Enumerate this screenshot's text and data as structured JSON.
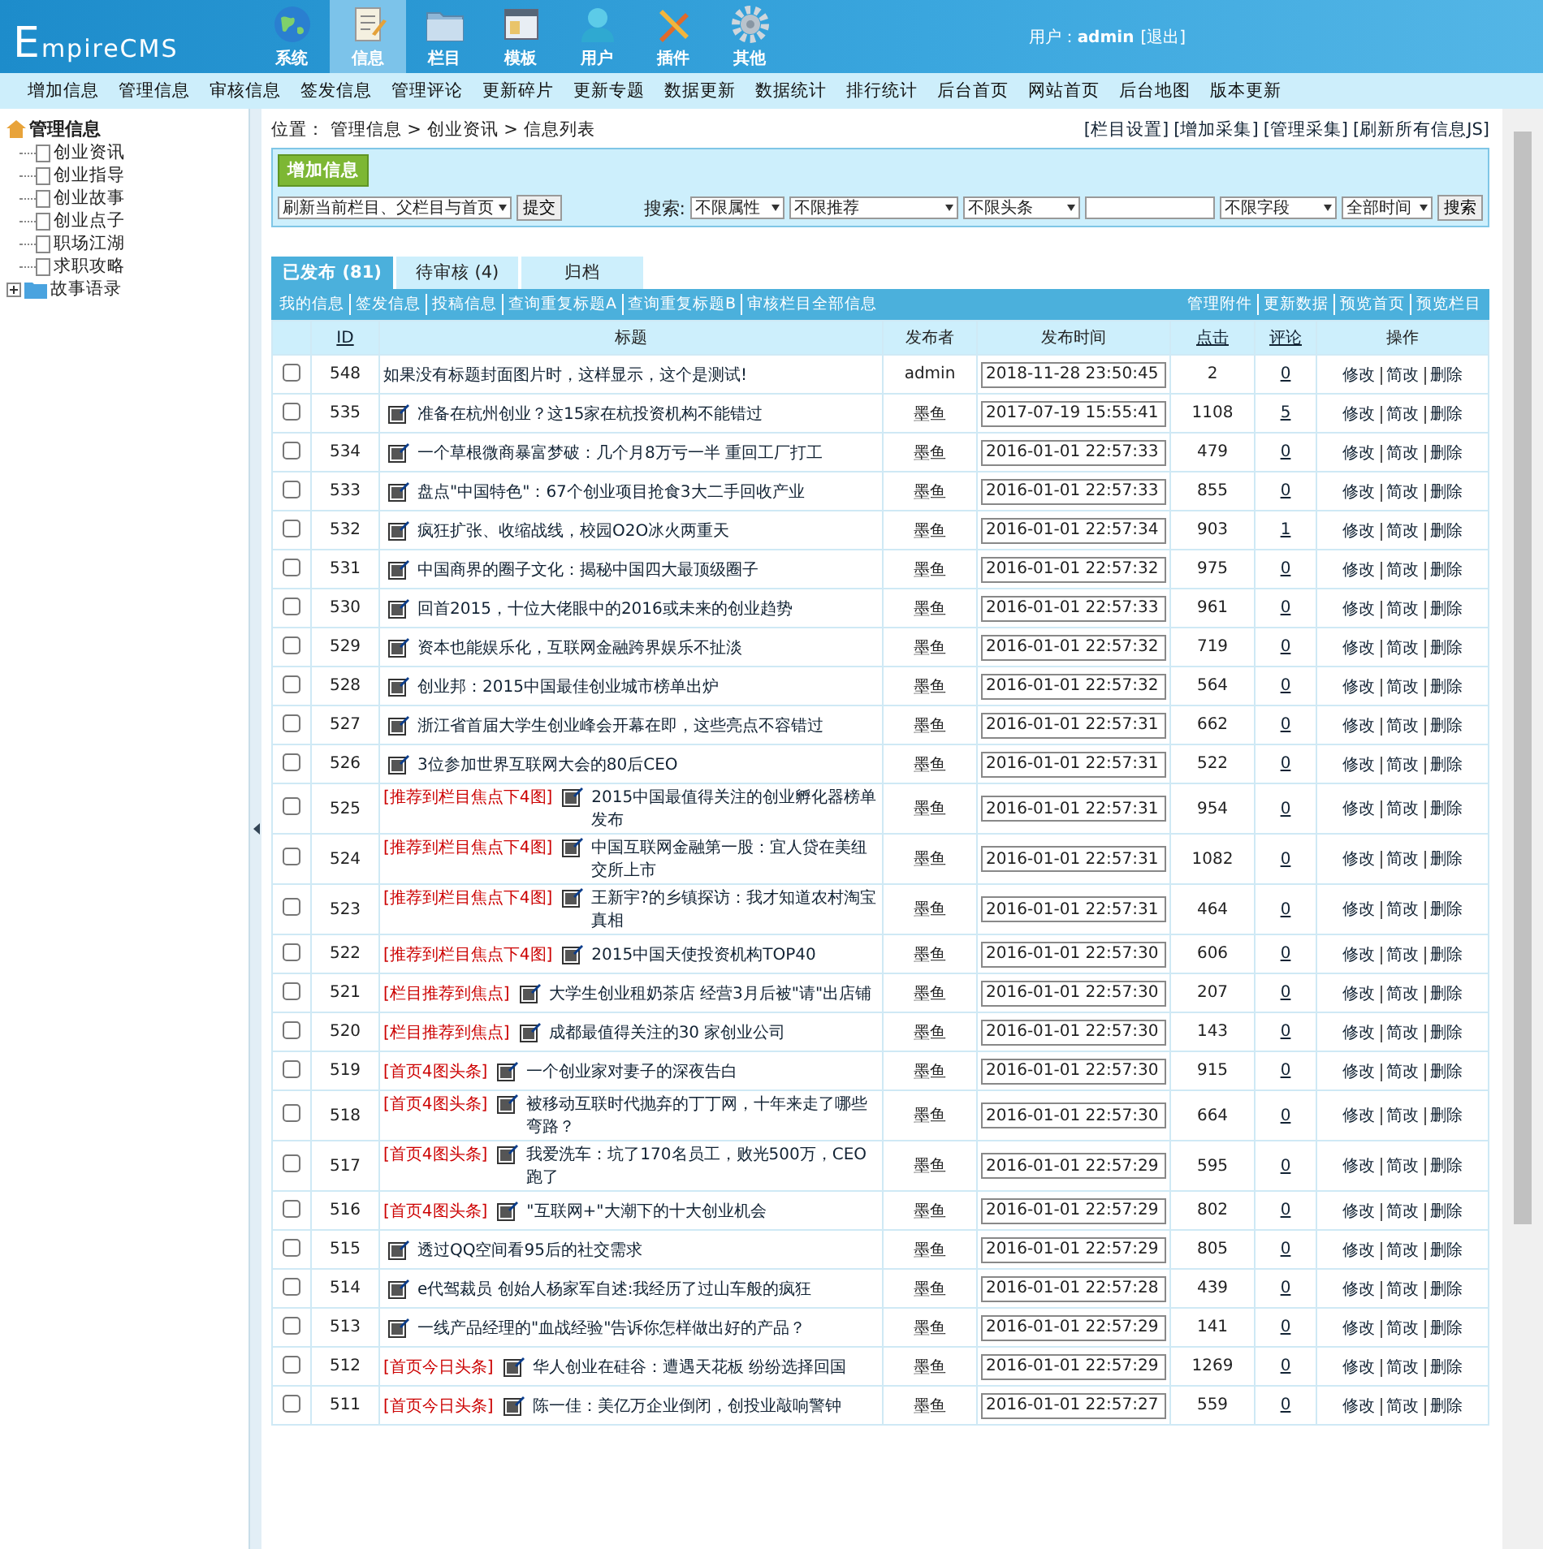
{
  "header": {
    "logo": "EmpireCMS",
    "nav": [
      {
        "label": "系统",
        "selected": false
      },
      {
        "label": "信息",
        "selected": true
      },
      {
        "label": "栏目",
        "selected": false
      },
      {
        "label": "模板",
        "selected": false
      },
      {
        "label": "用户",
        "selected": false
      },
      {
        "label": "插件",
        "selected": false
      },
      {
        "label": "其他",
        "selected": false
      }
    ],
    "user_label": "用户：",
    "user_name": "admin",
    "logout": "[退出]"
  },
  "menu": [
    "增加信息",
    "管理信息",
    "审核信息",
    "签发信息",
    "管理评论",
    "更新碎片",
    "更新专题",
    "数据更新",
    "数据统计",
    "排行统计",
    "后台首页",
    "网站首页",
    "后台地图",
    "版本更新"
  ],
  "sidebar": {
    "root": "管理信息",
    "items": [
      {
        "label": "创业资讯",
        "kind": "page"
      },
      {
        "label": "创业指导",
        "kind": "page"
      },
      {
        "label": "创业故事",
        "kind": "page"
      },
      {
        "label": "创业点子",
        "kind": "page"
      },
      {
        "label": "职场江湖",
        "kind": "page"
      },
      {
        "label": "求职攻略",
        "kind": "page"
      },
      {
        "label": "故事语录",
        "kind": "folder",
        "expanded": false
      }
    ]
  },
  "location": {
    "label": "位置：",
    "path": "管理信息 > 创业资讯 > 信息列表"
  },
  "top_links": [
    "[栏目设置]",
    "[增加采集]",
    "[管理采集]",
    "[刷新所有信息JS]"
  ],
  "add_button": "增加信息",
  "refresh_select": "刷新当前栏目、父栏目与首页",
  "submit": "提交",
  "search": {
    "label": "搜索:",
    "selects": [
      "不限属性",
      "不限推荐",
      "不限头条"
    ],
    "field_selects": [
      "不限字段",
      "全部时间"
    ],
    "button": "搜索"
  },
  "tabs": [
    {
      "label": "已发布 (81)",
      "selected": true
    },
    {
      "label": "待审核 (4)",
      "selected": false
    },
    {
      "label": "归档",
      "selected": false
    }
  ],
  "links_left": [
    "我的信息",
    "签发信息",
    "投稿信息",
    "查询重复标题A",
    "查询重复标题B",
    "审核栏目全部信息"
  ],
  "links_right": [
    "管理附件",
    "更新数据",
    "预览首页",
    "预览栏目"
  ],
  "table": {
    "columns": [
      "ID",
      "标题",
      "发布者",
      "发布时间",
      "点击",
      "评论",
      "操作"
    ],
    "rows": [
      {
        "checked": false,
        "id": "548",
        "tag": "",
        "picture": false,
        "title": "如果没有标题封面图片时，这样显示，这个是测试!",
        "publisher": "admin",
        "time": "2018-11-28 23:50:45",
        "clicks": "2",
        "comments": "0",
        "actions": [
          "修改",
          "简改",
          "删除"
        ]
      },
      {
        "checked": false,
        "id": "535",
        "tag": "",
        "picture": true,
        "title": "准备在杭州创业？这15家在杭投资机构不能错过",
        "publisher": "墨鱼",
        "time": "2017-07-19 15:55:41",
        "clicks": "1108",
        "comments": "5",
        "actions": [
          "修改",
          "简改",
          "删除"
        ]
      },
      {
        "checked": false,
        "id": "534",
        "tag": "",
        "picture": true,
        "title": "一个草根微商暴富梦破：几个月8万亏一半 重回工厂打工",
        "publisher": "墨鱼",
        "time": "2016-01-01 22:57:33",
        "clicks": "479",
        "comments": "0",
        "actions": [
          "修改",
          "简改",
          "删除"
        ]
      },
      {
        "checked": false,
        "id": "533",
        "tag": "",
        "picture": true,
        "title": "盘点\"中国特色\"：67个创业项目抢食3大二手回收产业",
        "publisher": "墨鱼",
        "time": "2016-01-01 22:57:33",
        "clicks": "855",
        "comments": "0",
        "actions": [
          "修改",
          "简改",
          "删除"
        ]
      },
      {
        "checked": false,
        "id": "532",
        "tag": "",
        "picture": true,
        "title": "疯狂扩张、收缩战线，校园O2O冰火两重天",
        "publisher": "墨鱼",
        "time": "2016-01-01 22:57:34",
        "clicks": "903",
        "comments": "1",
        "actions": [
          "修改",
          "简改",
          "删除"
        ]
      },
      {
        "checked": false,
        "id": "531",
        "tag": "",
        "picture": true,
        "title": "中国商界的圈子文化：揭秘中国四大最顶级圈子",
        "publisher": "墨鱼",
        "time": "2016-01-01 22:57:32",
        "clicks": "975",
        "comments": "0",
        "actions": [
          "修改",
          "简改",
          "删除"
        ]
      },
      {
        "checked": false,
        "id": "530",
        "tag": "",
        "picture": true,
        "title": "回首2015，十位大佬眼中的2016或未来的创业趋势",
        "publisher": "墨鱼",
        "time": "2016-01-01 22:57:33",
        "clicks": "961",
        "comments": "0",
        "actions": [
          "修改",
          "简改",
          "删除"
        ]
      },
      {
        "checked": false,
        "id": "529",
        "tag": "",
        "picture": true,
        "title": "资本也能娱乐化，互联网金融跨界娱乐不扯淡",
        "publisher": "墨鱼",
        "time": "2016-01-01 22:57:32",
        "clicks": "719",
        "comments": "0",
        "actions": [
          "修改",
          "简改",
          "删除"
        ]
      },
      {
        "checked": false,
        "id": "528",
        "tag": "",
        "picture": true,
        "title": "创业邦：2015中国最佳创业城市榜单出炉",
        "publisher": "墨鱼",
        "time": "2016-01-01 22:57:32",
        "clicks": "564",
        "comments": "0",
        "actions": [
          "修改",
          "简改",
          "删除"
        ]
      },
      {
        "checked": false,
        "id": "527",
        "tag": "",
        "picture": true,
        "title": "浙江省首届大学生创业峰会开幕在即，这些亮点不容错过",
        "publisher": "墨鱼",
        "time": "2016-01-01 22:57:31",
        "clicks": "662",
        "comments": "0",
        "actions": [
          "修改",
          "简改",
          "删除"
        ]
      },
      {
        "checked": false,
        "id": "526",
        "tag": "",
        "picture": true,
        "title": "3位参加世界互联网大会的80后CEO",
        "publisher": "墨鱼",
        "time": "2016-01-01 22:57:31",
        "clicks": "522",
        "comments": "0",
        "actions": [
          "修改",
          "简改",
          "删除"
        ]
      },
      {
        "checked": false,
        "id": "525",
        "tag": "[推荐到栏目焦点下4图]",
        "picture": true,
        "title": "2015中国最值得关注的创业孵化器榜单发布",
        "publisher": "墨鱼",
        "time": "2016-01-01 22:57:31",
        "clicks": "954",
        "comments": "0",
        "actions": [
          "修改",
          "简改",
          "删除"
        ]
      },
      {
        "checked": false,
        "id": "524",
        "tag": "[推荐到栏目焦点下4图]",
        "picture": true,
        "title": "中国互联网金融第一股：宜人贷在美纽交所上市",
        "publisher": "墨鱼",
        "time": "2016-01-01 22:57:31",
        "clicks": "1082",
        "comments": "0",
        "actions": [
          "修改",
          "简改",
          "删除"
        ]
      },
      {
        "checked": false,
        "id": "523",
        "tag": "[推荐到栏目焦点下4图]",
        "picture": true,
        "title": "王新宇?的乡镇探访：我才知道农村淘宝真相",
        "publisher": "墨鱼",
        "time": "2016-01-01 22:57:31",
        "clicks": "464",
        "comments": "0",
        "actions": [
          "修改",
          "简改",
          "删除"
        ]
      },
      {
        "checked": false,
        "id": "522",
        "tag": "[推荐到栏目焦点下4图]",
        "picture": true,
        "title": "2015中国天使投资机构TOP40",
        "publisher": "墨鱼",
        "time": "2016-01-01 22:57:30",
        "clicks": "606",
        "comments": "0",
        "actions": [
          "修改",
          "简改",
          "删除"
        ]
      },
      {
        "checked": false,
        "id": "521",
        "tag": "[栏目推荐到焦点]",
        "picture": true,
        "title": "大学生创业租奶茶店 经营3月后被\"请\"出店铺",
        "publisher": "墨鱼",
        "time": "2016-01-01 22:57:30",
        "clicks": "207",
        "comments": "0",
        "actions": [
          "修改",
          "简改",
          "删除"
        ]
      },
      {
        "checked": false,
        "id": "520",
        "tag": "[栏目推荐到焦点]",
        "picture": true,
        "title": "成都最值得关注的30 家创业公司",
        "publisher": "墨鱼",
        "time": "2016-01-01 22:57:30",
        "clicks": "143",
        "comments": "0",
        "actions": [
          "修改",
          "简改",
          "删除"
        ]
      },
      {
        "checked": false,
        "id": "519",
        "tag": "[首页4图头条]",
        "picture": true,
        "title": "一个创业家对妻子的深夜告白",
        "publisher": "墨鱼",
        "time": "2016-01-01 22:57:30",
        "clicks": "915",
        "comments": "0",
        "actions": [
          "修改",
          "简改",
          "删除"
        ]
      },
      {
        "checked": false,
        "id": "518",
        "tag": "[首页4图头条]",
        "picture": true,
        "title": "被移动互联时代抛弃的丁丁网，十年来走了哪些弯路？",
        "publisher": "墨鱼",
        "time": "2016-01-01 22:57:30",
        "clicks": "664",
        "comments": "0",
        "actions": [
          "修改",
          "简改",
          "删除"
        ]
      },
      {
        "checked": false,
        "id": "517",
        "tag": "[首页4图头条]",
        "picture": true,
        "title": "我爱洗车：坑了170名员工，败光500万，CEO跑了",
        "publisher": "墨鱼",
        "time": "2016-01-01 22:57:29",
        "clicks": "595",
        "comments": "0",
        "actions": [
          "修改",
          "简改",
          "删除"
        ]
      },
      {
        "checked": false,
        "id": "516",
        "tag": "[首页4图头条]",
        "picture": true,
        "title": "\"互联网+\"大潮下的十大创业机会",
        "publisher": "墨鱼",
        "time": "2016-01-01 22:57:29",
        "clicks": "802",
        "comments": "0",
        "actions": [
          "修改",
          "简改",
          "删除"
        ]
      },
      {
        "checked": false,
        "id": "515",
        "tag": "",
        "picture": true,
        "title": "透过QQ空间看95后的社交需求",
        "publisher": "墨鱼",
        "time": "2016-01-01 22:57:29",
        "clicks": "805",
        "comments": "0",
        "actions": [
          "修改",
          "简改",
          "删除"
        ]
      },
      {
        "checked": false,
        "id": "514",
        "tag": "",
        "picture": true,
        "title": "e代驾裁员 创始人杨家军自述:我经历了过山车般的疯狂",
        "publisher": "墨鱼",
        "time": "2016-01-01 22:57:28",
        "clicks": "439",
        "comments": "0",
        "actions": [
          "修改",
          "简改",
          "删除"
        ]
      },
      {
        "checked": false,
        "id": "513",
        "tag": "",
        "picture": true,
        "title": "一线产品经理的\"血战经验\"告诉你怎样做出好的产品？",
        "publisher": "墨鱼",
        "time": "2016-01-01 22:57:29",
        "clicks": "141",
        "comments": "0",
        "actions": [
          "修改",
          "简改",
          "删除"
        ]
      },
      {
        "checked": false,
        "id": "512",
        "tag": "[首页今日头条]",
        "picture": true,
        "title": "华人创业在硅谷：遭遇天花板 纷纷选择回国",
        "publisher": "墨鱼",
        "time": "2016-01-01 22:57:29",
        "clicks": "1269",
        "comments": "0",
        "actions": [
          "修改",
          "简改",
          "删除"
        ]
      },
      {
        "checked": false,
        "id": "511",
        "tag": "[首页今日头条]",
        "picture": true,
        "title": "陈一佳：美亿万企业倒闭，创投业敲响警钟",
        "publisher": "墨鱼",
        "time": "2016-01-01 22:57:27",
        "clicks": "559",
        "comments": "0",
        "actions": [
          "修改",
          "简改",
          "删除"
        ]
      }
    ]
  }
}
